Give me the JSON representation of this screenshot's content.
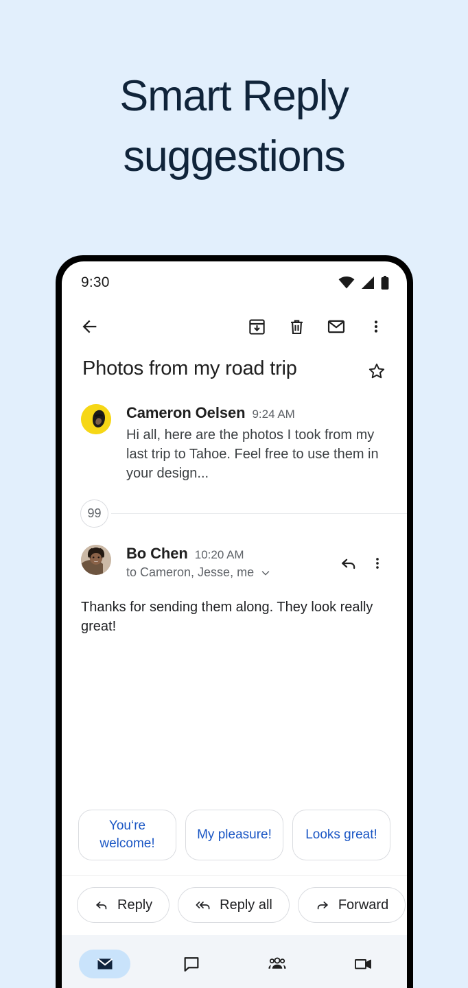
{
  "page": {
    "background_color": "#e2effc",
    "headline_line1": "Smart Reply",
    "headline_line2": "suggestions",
    "headline_color": "#10243a"
  },
  "status_bar": {
    "time": "9:30",
    "icons": [
      "wifi-icon",
      "cellular-signal-icon",
      "battery-icon"
    ]
  },
  "toolbar": {
    "back_label": "Back",
    "archive_label": "Archive",
    "delete_label": "Delete",
    "mark_unread_label": "Mark as unread",
    "more_label": "More options"
  },
  "thread": {
    "subject": "Photos from my road trip",
    "star_label": "Star",
    "collapsed_count": "99",
    "messages": [
      {
        "sender": "Cameron Oelsen",
        "time": "9:24 AM",
        "snippet": "Hi all, here are the photos I took from my last trip to Tahoe. Feel free to use them in your design...",
        "avatar_color": "#f6d716"
      },
      {
        "sender": "Bo Chen",
        "time": "10:20 AM",
        "recipients": "to Cameron, Jesse, me",
        "body": "Thanks for sending them along. They look really great!",
        "avatar_color": "#b9a392",
        "reply_label": "Reply",
        "more_label": "More options"
      }
    ]
  },
  "smart_replies": {
    "accent_color": "#1a56c4",
    "chips": [
      {
        "text": "You‘re welcome!"
      },
      {
        "text": "My pleasure!"
      },
      {
        "text": "Looks great!"
      }
    ]
  },
  "reply_bar": {
    "buttons": [
      {
        "label": "Reply",
        "icon": "reply-icon"
      },
      {
        "label": "Reply all",
        "icon": "reply-all-icon"
      },
      {
        "label": "Forward",
        "icon": "forward-icon"
      }
    ]
  },
  "bottom_nav": {
    "active_pill_color": "#c9e3fb",
    "items": [
      {
        "name": "mail",
        "icon": "mail-icon",
        "active": true
      },
      {
        "name": "chat",
        "icon": "chat-bubble-icon",
        "active": false
      },
      {
        "name": "spaces",
        "icon": "people-group-icon",
        "active": false
      },
      {
        "name": "meet",
        "icon": "video-camera-icon",
        "active": false
      }
    ]
  }
}
